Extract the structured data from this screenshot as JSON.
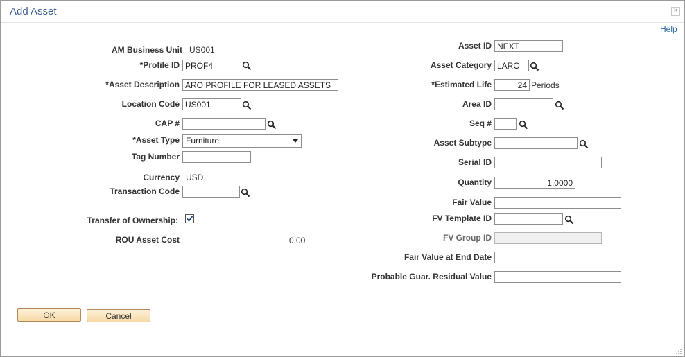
{
  "dialog": {
    "title": "Add Asset",
    "help_label": "Help"
  },
  "left": {
    "am_business_unit": {
      "label": "AM Business Unit",
      "value": "US001"
    },
    "profile_id": {
      "label": "*Profile ID",
      "value": "PROF4"
    },
    "asset_description": {
      "label": "*Asset Description",
      "value": "ARO PROFILE FOR LEASED ASSETS"
    },
    "location_code": {
      "label": "Location Code",
      "value": "US001"
    },
    "cap_no": {
      "label": "CAP #",
      "value": ""
    },
    "asset_type": {
      "label": "*Asset Type",
      "value": "Furniture"
    },
    "tag_number": {
      "label": "Tag Number",
      "value": ""
    },
    "currency": {
      "label": "Currency",
      "value": "USD"
    },
    "transaction_code": {
      "label": "Transaction Code",
      "value": ""
    },
    "transfer_of_ownership": {
      "label": "Transfer of Ownership:",
      "checked": true
    },
    "rou_asset_cost": {
      "label": "ROU Asset Cost",
      "value": "0.00"
    }
  },
  "right": {
    "asset_id": {
      "label": "Asset ID",
      "value": "NEXT"
    },
    "asset_category": {
      "label": "Asset Category",
      "value": "LARO"
    },
    "estimated_life": {
      "label": "*Estimated Life",
      "value": "24",
      "unit": "Periods"
    },
    "area_id": {
      "label": "Area ID",
      "value": ""
    },
    "seq_no": {
      "label": "Seq #",
      "value": ""
    },
    "asset_subtype": {
      "label": "Asset Subtype",
      "value": ""
    },
    "serial_id": {
      "label": "Serial ID",
      "value": ""
    },
    "quantity": {
      "label": "Quantity",
      "value": "1.0000"
    },
    "fair_value": {
      "label": "Fair Value",
      "value": ""
    },
    "fv_template_id": {
      "label": "FV Template ID",
      "value": ""
    },
    "fv_group_id": {
      "label": "FV Group ID",
      "value": ""
    },
    "fair_value_end_date": {
      "label": "Fair Value at End Date",
      "value": ""
    },
    "probable_guar_residual": {
      "label": "Probable Guar. Residual Value",
      "value": ""
    }
  },
  "buttons": {
    "ok": "OK",
    "cancel": "Cancel"
  },
  "icons": {
    "lookup": "magnifier-icon",
    "close": "close-icon",
    "checkbox": "checkmark-icon",
    "resize": "resize-grip-icon"
  }
}
